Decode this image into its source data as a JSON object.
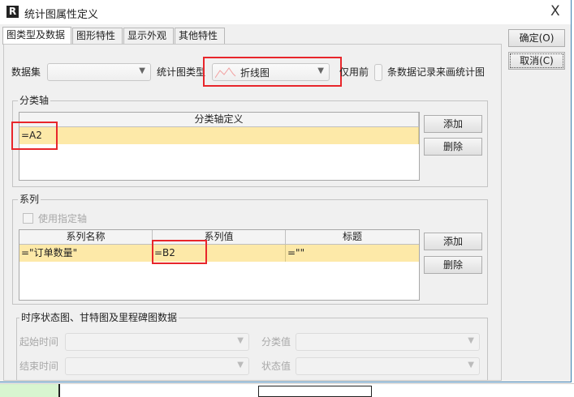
{
  "window": {
    "title": "统计图属性定义",
    "close": "X"
  },
  "tabs": [
    {
      "label": "图类型及数据"
    },
    {
      "label": "图形特性"
    },
    {
      "label": "显示外观"
    },
    {
      "label": "其他特性"
    }
  ],
  "actions": {
    "ok": "确定(O)",
    "cancel": "取消(C)"
  },
  "top_row": {
    "dataset_label": "数据集",
    "dataset_value": "",
    "chart_type_label": "统计图类型",
    "chart_type_value": "折线图",
    "use_first_label": "仅用前",
    "use_first_value": "",
    "use_first_suffix": "条数据记录来画统计图"
  },
  "category_axis": {
    "title": "分类轴",
    "column": "分类轴定义",
    "rows": [
      "=A2"
    ],
    "add": "添加",
    "delete": "删除"
  },
  "series": {
    "title": "系列",
    "use_axis_label": "使用指定轴",
    "columns": [
      "系列名称",
      "系列值",
      "标题"
    ],
    "rows": [
      [
        "=\"订单数量\"",
        "=B2",
        "=\"\""
      ]
    ],
    "add": "添加",
    "delete": "删除"
  },
  "timeline": {
    "title": "时序状态图、甘特图及里程碑图数据",
    "start_label": "起始时间",
    "end_label": "结束时间",
    "category_label": "分类值",
    "status_label": "状态值"
  }
}
